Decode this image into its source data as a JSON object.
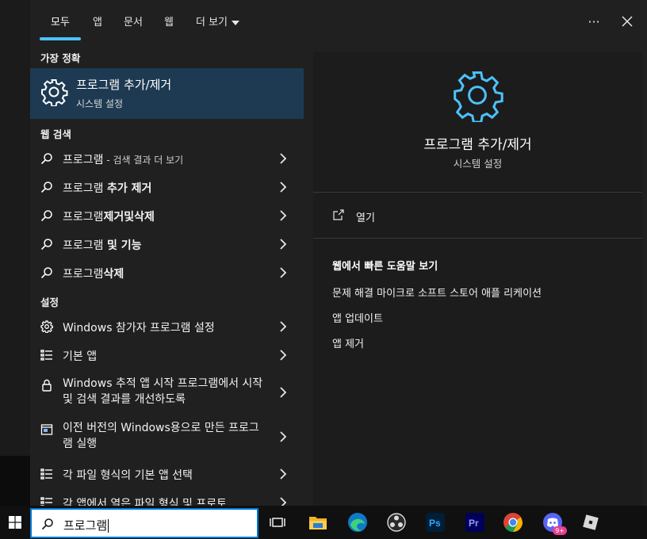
{
  "tabs": [
    {
      "label": "모두",
      "active": true
    },
    {
      "label": "앱"
    },
    {
      "label": "문서"
    },
    {
      "label": "웹"
    },
    {
      "label": "더 보기"
    }
  ],
  "top_buttons": {
    "more": "···",
    "close": "✕"
  },
  "sections": {
    "best": "가장 정확",
    "web": "웹 검색",
    "settings": "설정"
  },
  "best_match": {
    "title": "프로그램 추가/제거",
    "subtitle": "시스템 설정",
    "icon": "gear-icon"
  },
  "web_results": [
    {
      "main": "프로그램",
      "suffix": " - 검색 결과 더 보기"
    },
    {
      "pre": "프로그램 ",
      "bold": "추가 제거"
    },
    {
      "pre": "프로그램",
      "bold": "제거및삭제"
    },
    {
      "pre": "프로그램 ",
      "bold": "및 기능"
    },
    {
      "pre": "프로그램",
      "bold": "삭제"
    }
  ],
  "settings_results": [
    {
      "icon": "gear-icon",
      "text": "Windows 참가자 프로그램 설정"
    },
    {
      "icon": "list-icon",
      "text": "기본 앱"
    },
    {
      "icon": "lock-icon",
      "text": "Windows 추적 앱 시작 프로그램에서 시작 및 검색 결과를 개선하도록"
    },
    {
      "icon": "window-icon",
      "text": "이전 버전의 Windows용으로 만든 프로그램 실행"
    },
    {
      "icon": "list-icon",
      "text": "각 파일 형식의 기본 앱 선택"
    },
    {
      "icon": "list-icon",
      "text": "각 앱에서 열은 파일 형식 및 프로토"
    }
  ],
  "preview": {
    "title": "프로그램 추가/제거",
    "subtitle": "시스템 설정",
    "open_label": "열기",
    "help_heading": "웹에서 빠른 도움말 보기",
    "help_links": [
      "문제 해결 마이크로 소프트 스토어 애플 리케이션",
      "앱 업데이트",
      "앱 제거"
    ]
  },
  "taskbar": {
    "search_value": "프로그램",
    "icons": [
      "task-view-icon",
      "file-explorer-icon",
      "edge-icon",
      "obs-icon",
      "photoshop-icon",
      "premiere-icon",
      "chrome-icon",
      "discord-icon",
      "roblox-icon"
    ],
    "discord_badge": "9+",
    "ps_label": "Ps",
    "pr_label": "Pr"
  },
  "colors": {
    "accent": "#4cc2ff",
    "selected_row": "#1e3a52",
    "panel": "#202020",
    "preview": "#1c1c1c"
  }
}
